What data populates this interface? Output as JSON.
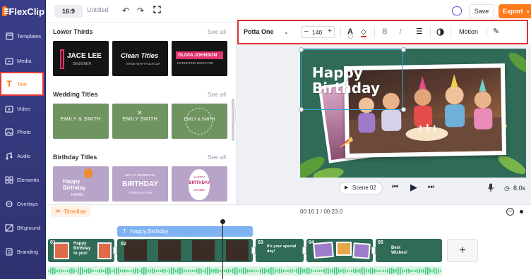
{
  "app": {
    "name": "FlexClip",
    "brand_color": "#ff7a1a",
    "sidebar_color": "#363a80"
  },
  "sidebar": {
    "items": [
      {
        "label": "Templates",
        "icon": "templates-icon"
      },
      {
        "label": "Media",
        "icon": "media-icon"
      },
      {
        "label": "Text",
        "icon": "text-icon",
        "active": true
      },
      {
        "label": "Video",
        "icon": "video-icon"
      },
      {
        "label": "Photo",
        "icon": "photo-icon"
      },
      {
        "label": "Audio",
        "icon": "audio-icon"
      },
      {
        "label": "Elements",
        "icon": "elements-icon"
      },
      {
        "label": "Overlays",
        "icon": "overlays-icon"
      },
      {
        "label": "BKground",
        "icon": "background-icon"
      },
      {
        "label": "Branding",
        "icon": "branding-icon"
      }
    ]
  },
  "topbar": {
    "aspect_ratio": "16:9",
    "project_title": "Untitled",
    "save_label": "Save",
    "export_label": "Export"
  },
  "text_toolbar": {
    "font_name": "Potta One",
    "font_size": "140",
    "minus": "–",
    "plus": "+",
    "motion_label": "Motion"
  },
  "panel": {
    "sections": [
      {
        "title": "Lower Thirds",
        "see_all": "See all",
        "thumbs": [
          {
            "line1": "JACE LEE",
            "line2": "DESIGNER"
          },
          {
            "line1": "Clean Titles",
            "line2": "MADE WITH FLEXCLIP"
          },
          {
            "line1": "OLIVIA JOHNSON",
            "line2": "MARKETING DIRECTOR"
          }
        ]
      },
      {
        "title": "Wedding Titles",
        "see_all": "See all",
        "thumbs": [
          {
            "line1": "EMILY & SMITH"
          },
          {
            "line1": "EMILY SMITH"
          },
          {
            "line1": "EMILY & SMITH"
          }
        ]
      },
      {
        "title": "Birthday Titles",
        "see_all": "See all",
        "thumbs": [
          {
            "line1": "Happy",
            "line2": "Birthday",
            "line3": "DANIEL"
          },
          {
            "line1": "LET US CELEBRATE",
            "line2": "BIRTHDAY",
            "line3": "YOUR CAPTION"
          },
          {
            "line1": "HAPPY",
            "line2": "BIRTHDAY",
            "line3": "DANIEL"
          }
        ]
      }
    ]
  },
  "canvas": {
    "headline_line1": "Happy",
    "headline_line2": "Birthday"
  },
  "player": {
    "scene_label": "Scene 02",
    "duration": "8.0s"
  },
  "timeline": {
    "tab_label": "Timeline",
    "time_readout": "00:10.1 / 00:23.0",
    "text_track_label": "Happy,Birthday",
    "scenes": [
      {
        "num": "01"
      },
      {
        "num": "02"
      },
      {
        "num": "03",
        "caption": "It's your special day!"
      },
      {
        "num": "04"
      },
      {
        "num": "05",
        "caption": "Best Wishes!"
      }
    ],
    "add_label": "+"
  }
}
